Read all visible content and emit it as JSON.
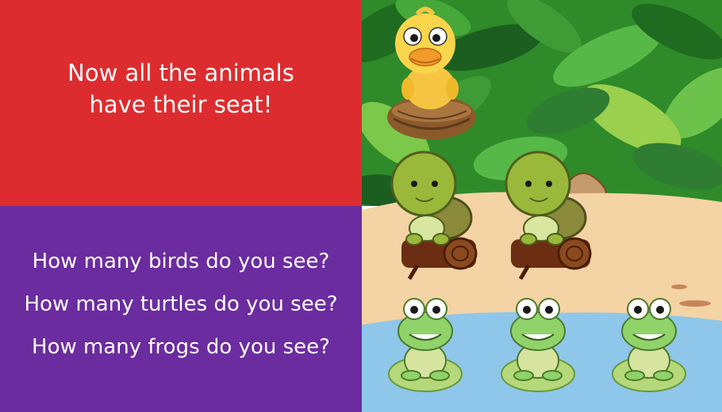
{
  "slide": {
    "headline": "Now all the animals have their seat!",
    "questions": [
      "How many birds do you see?",
      "How many turtles do you see?",
      "How many frogs do you see?"
    ]
  },
  "colors": {
    "top_panel": "#dd2c2f",
    "bottom_panel": "#6b2c9f",
    "text": "#ffffff",
    "jungle": "#2f8a2a",
    "sand": "#f4d3a4",
    "water": "#8ec7ea",
    "log": "#6b2e12"
  },
  "scene": {
    "birds": 1,
    "turtles": 2,
    "frogs": 3
  }
}
